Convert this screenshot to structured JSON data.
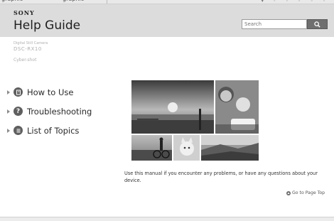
{
  "browser": {
    "tab_1": "graphic",
    "tab_2": "graphic"
  },
  "header": {
    "brand": "SONY",
    "title": "Help Guide",
    "search_placeholder": "Search"
  },
  "model": {
    "line_1": "Digital Still Camera",
    "line_2": "DSC-RX10",
    "line_3": "Cyber-shot"
  },
  "nav": [
    {
      "label": "How to Use",
      "icon": "book-icon"
    },
    {
      "label": "Troubleshooting",
      "icon": "question-icon"
    },
    {
      "label": "List of Topics",
      "icon": "list-icon"
    }
  ],
  "description": "Use this manual if you encounter any problems, or have any questions about your device.",
  "page_top": "Go to Page Top"
}
